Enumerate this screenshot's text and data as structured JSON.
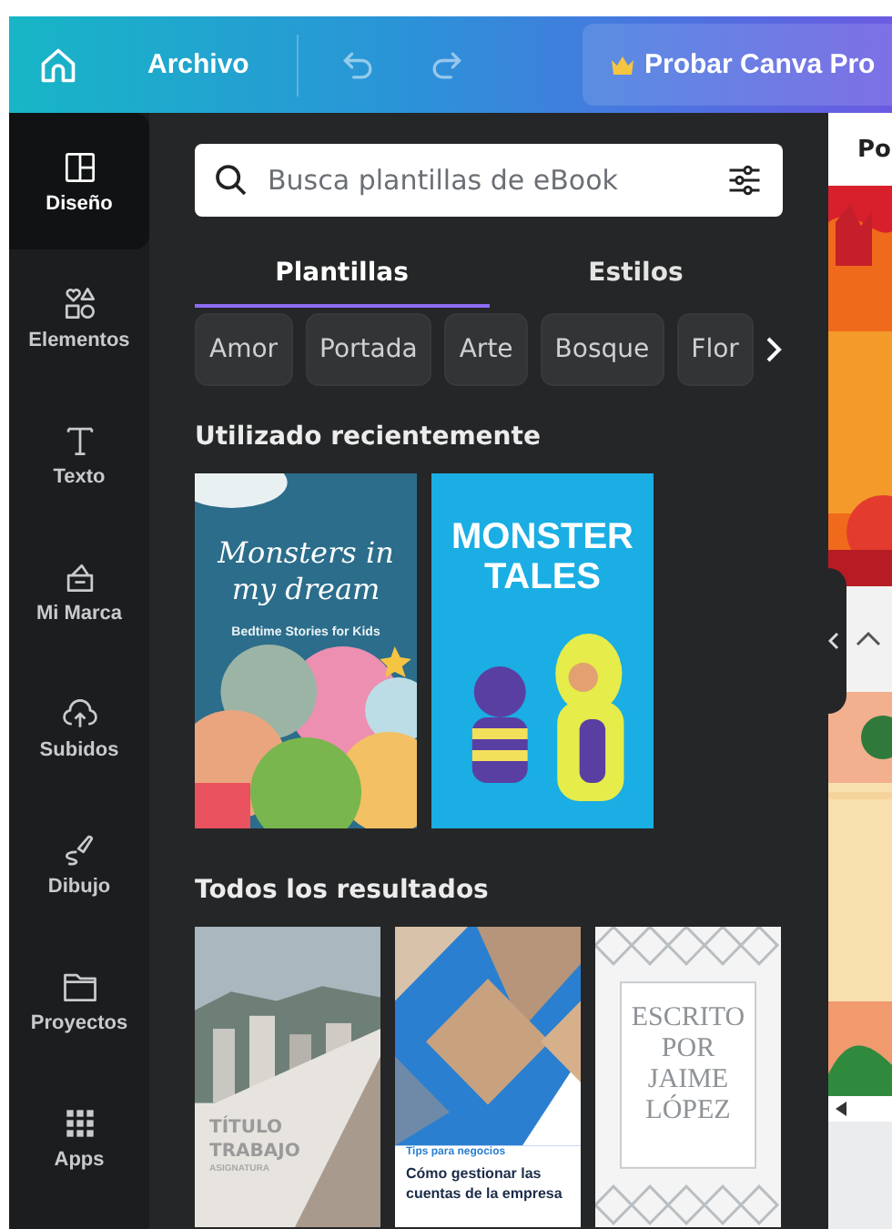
{
  "topbar": {
    "file_menu": "Archivo",
    "pro_button": "Probar Canva Pro"
  },
  "sidebar": {
    "items": [
      {
        "label": "Diseño",
        "selected": true
      },
      {
        "label": "Elementos",
        "selected": false
      },
      {
        "label": "Texto",
        "selected": false
      },
      {
        "label": "Mi Marca",
        "selected": false
      },
      {
        "label": "Subidos",
        "selected": false
      },
      {
        "label": "Dibujo",
        "selected": false
      },
      {
        "label": "Proyectos",
        "selected": false
      },
      {
        "label": "Apps",
        "selected": false
      }
    ]
  },
  "panel": {
    "search": {
      "placeholder": "Busca plantillas de eBook"
    },
    "tabs": [
      {
        "label": "Plantillas",
        "selected": true
      },
      {
        "label": "Estilos",
        "selected": false
      }
    ],
    "chips": [
      "Amor",
      "Portada",
      "Arte",
      "Bosque",
      "Flor"
    ],
    "sections": [
      {
        "heading": "Utilizado recientemente",
        "templates": [
          {
            "title": "Monsters in my dream",
            "subtitle": "Bedtime Stories for Kids"
          },
          {
            "title": "MONSTER TALES"
          }
        ]
      },
      {
        "heading": "Todos los resultados",
        "templates": [
          {
            "title": "TÍTULO TRABAJO",
            "subtitle": "ASIGNATURA"
          },
          {
            "title": "Cómo gestionar las cuentas de la empresa",
            "subtitle": "Tips para negocios"
          },
          {
            "title": "ESCRITO POR JAIME LÓPEZ"
          }
        ]
      }
    ]
  },
  "canvas": {
    "page_tab": "Po"
  }
}
